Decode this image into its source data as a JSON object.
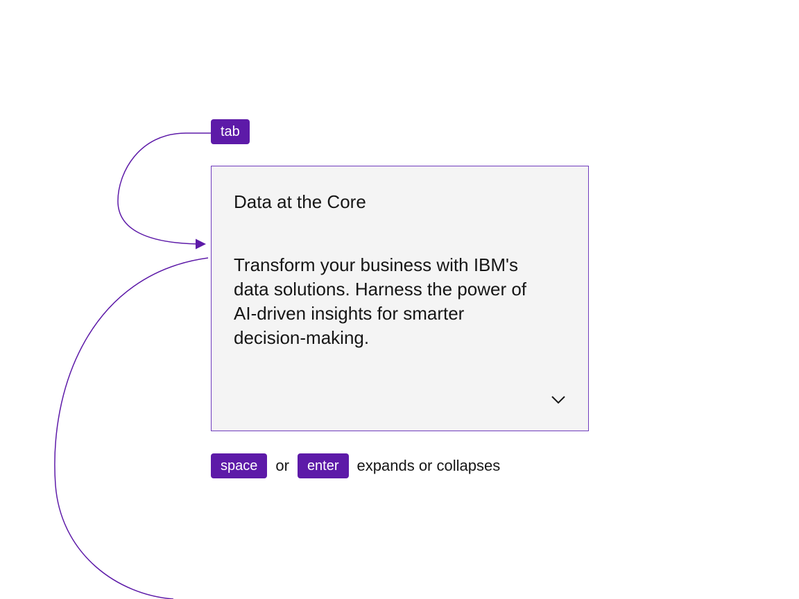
{
  "colors": {
    "accent": "#5d1aa8",
    "card_border": "#6f3bbd",
    "card_bg": "#f4f4f4",
    "text": "#161616"
  },
  "keys": {
    "tab": "tab",
    "space": "space",
    "enter": "enter"
  },
  "hint": {
    "or": "or",
    "action": "expands or collapses"
  },
  "card": {
    "title": "Data at the Core",
    "body": "Transform your business with IBM's data solutions. Harness the power of AI-driven insights for smarter decision-making."
  }
}
